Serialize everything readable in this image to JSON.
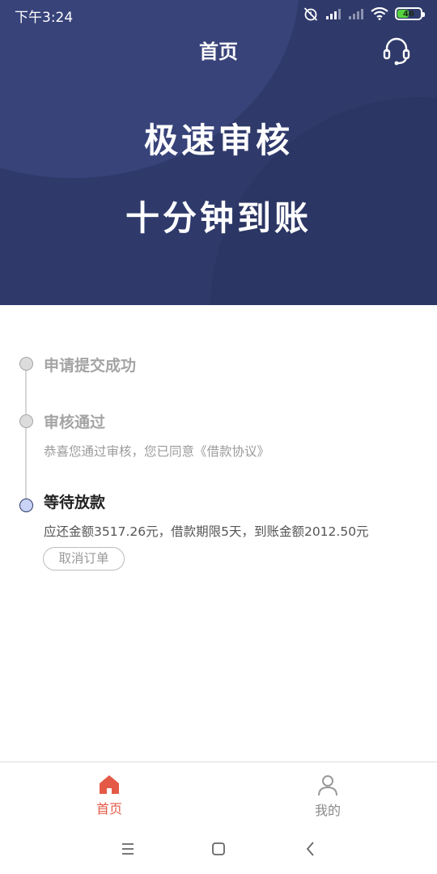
{
  "status_bar": {
    "time": "下午3:24",
    "battery_level": "46"
  },
  "header": {
    "title": "首页"
  },
  "banner": {
    "slogan_line1": "极速审核",
    "slogan_line2": "十分钟到账"
  },
  "timeline": {
    "steps": [
      {
        "title": "申请提交成功",
        "desc": ""
      },
      {
        "title": "审核通过",
        "desc": "恭喜您通过审核，您已同意《借款协议》"
      },
      {
        "title": "等待放款",
        "desc": "应还金额3517.26元，借款期限5天，到账金额2012.50元"
      }
    ],
    "cancel_label": "取消订单"
  },
  "tabbar": {
    "items": [
      {
        "label": "首页",
        "icon": "home-icon",
        "active": true
      },
      {
        "label": "我的",
        "icon": "user-icon",
        "active": false
      }
    ]
  },
  "colors": {
    "banner": "#2f3a6b",
    "accent": "#e45a46",
    "active_dot": "#c9d3f5"
  }
}
